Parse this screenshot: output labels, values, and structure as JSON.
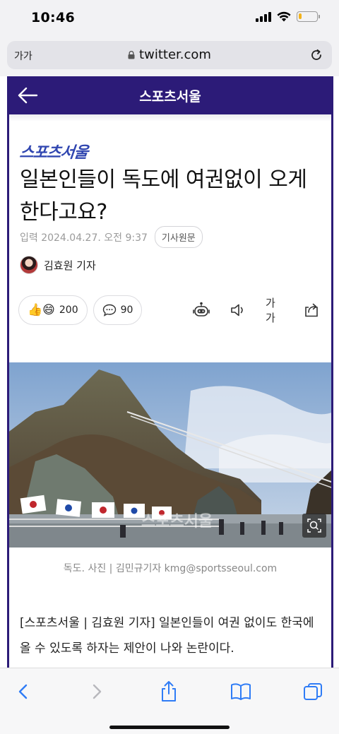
{
  "status": {
    "time": "10:46",
    "battery_level": 0.18
  },
  "browser": {
    "text_size_label": "가가",
    "url": "twitter.com"
  },
  "site_header": {
    "title": "스포츠서울"
  },
  "article": {
    "logo": "스포츠서울",
    "headline": "일본인들이 독도에 여권없이 오게 한다고요?",
    "date": "입력 2024.04.27. 오전 9:37",
    "origin_button": "기사원문",
    "author": "김효원 기자",
    "reactions": {
      "likes": "200",
      "comments": "90"
    },
    "font_size_label": "가가",
    "photo_caption": "독도. 사진 | 김민규기자 kmg@sportsseoul.com",
    "photo_watermark": "스포츠서울",
    "body": "[스포츠서울 | 김효원 기자] 일본인들이 여권 없이도 한국에 올 수 있도록 하자는 제안이 나와 논란이다."
  },
  "colors": {
    "brand": "#2c1b78",
    "logo": "#3046b0",
    "safari_blue": "#2f7cf6"
  }
}
